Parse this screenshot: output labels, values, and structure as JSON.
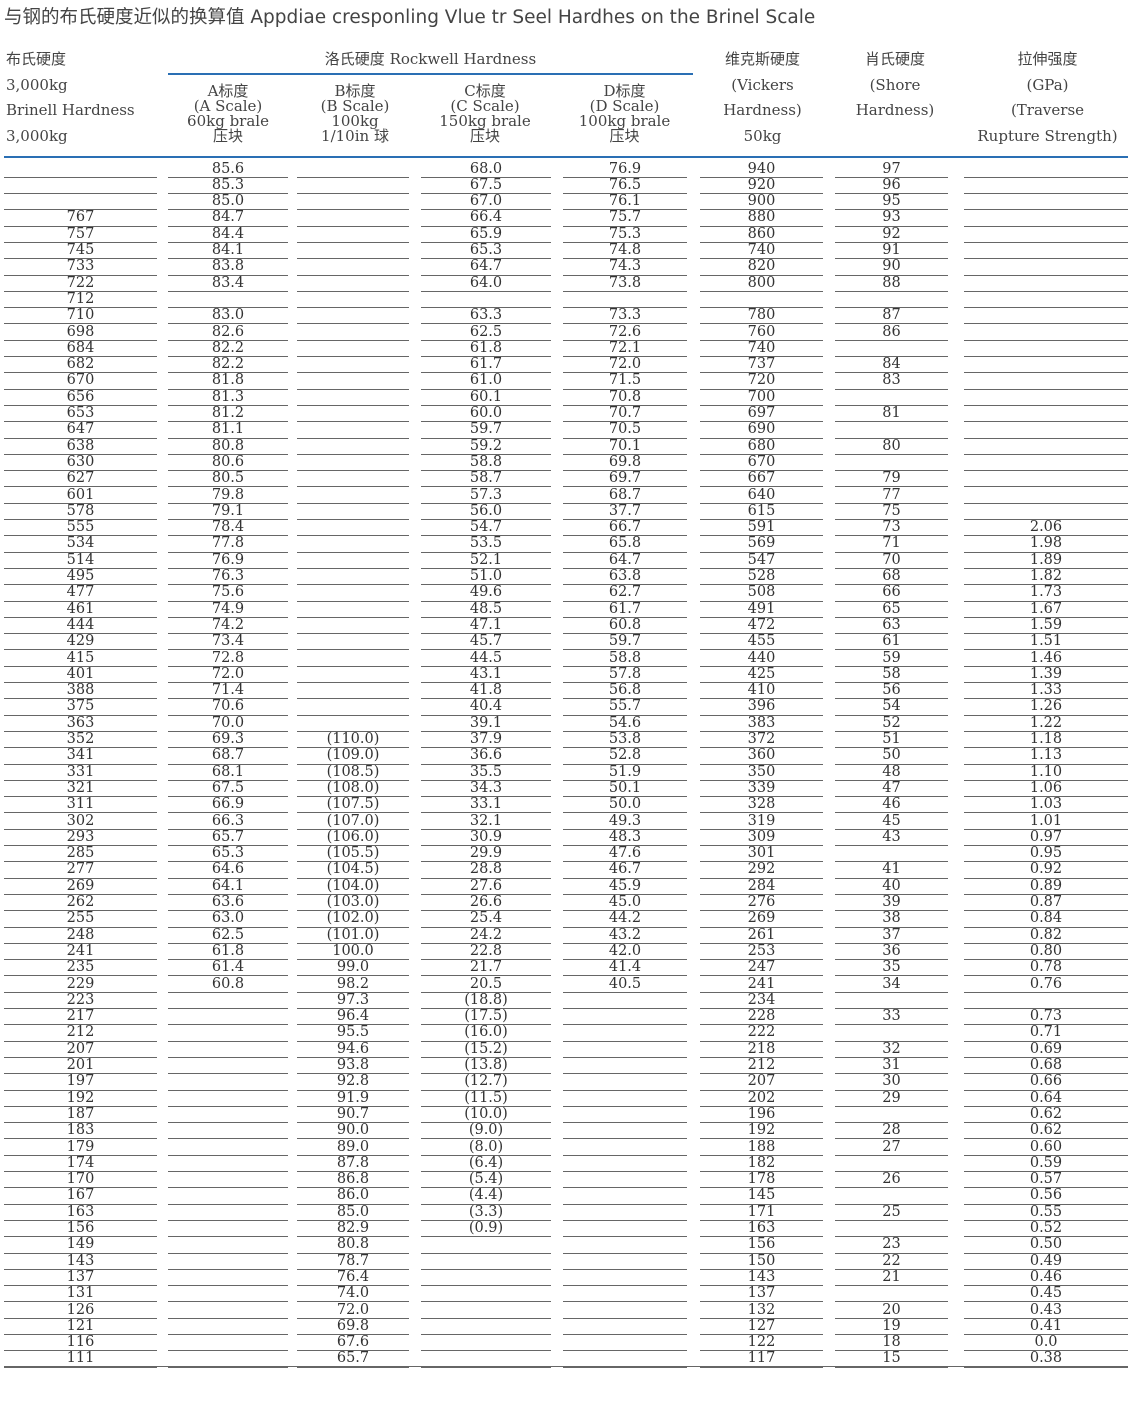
{
  "title": "与钢的布氏硬度近似的换算值 Appdiae cresponling Vlue tr Seel Hardhes on the Brinel Scale",
  "header": {
    "brinell": [
      "布氏硬度",
      "3,000kg",
      "Brinell Hardness",
      "3,000kg"
    ],
    "rockwell": "洛氏硬度 Rockwell Hardness",
    "a_scale": [
      "A标度",
      "(A Scale)",
      "60kg brale",
      "压块"
    ],
    "b_scale": [
      "B标度",
      "(B Scale)",
      "100kg",
      "1/10in 球"
    ],
    "c_scale": [
      "C标度",
      "(C Scale)",
      "150kg brale",
      "压块"
    ],
    "d_scale": [
      "D标度",
      "(D Scale)",
      "100kg brale",
      "压块"
    ],
    "vickers": [
      "维克斯硬度",
      "(Vickers",
      "Hardness)",
      "50kg"
    ],
    "shore": [
      "肖氏硬度",
      "(Shore",
      "Hardness)"
    ],
    "tensile": [
      "拉伸强度",
      "(GPa)",
      "(Traverse",
      "Rupture Strength)"
    ]
  },
  "rows": [
    [
      "",
      "85.6",
      "",
      "68.0",
      "76.9",
      "940",
      "97",
      ""
    ],
    [
      "",
      "85.3",
      "",
      "67.5",
      "76.5",
      "920",
      "96",
      ""
    ],
    [
      "",
      "85.0",
      "",
      "67.0",
      "76.1",
      "900",
      "95",
      ""
    ],
    [
      "767",
      "84.7",
      "",
      "66.4",
      "75.7",
      "880",
      "93",
      ""
    ],
    [
      "757",
      "84.4",
      "",
      "65.9",
      "75.3",
      "860",
      "92",
      ""
    ],
    [
      "745",
      "84.1",
      "",
      "65.3",
      "74.8",
      "740",
      "91",
      ""
    ],
    [
      "733",
      "83.8",
      "",
      "64.7",
      "74.3",
      "820",
      "90",
      ""
    ],
    [
      "722",
      "83.4",
      "",
      "64.0",
      "73.8",
      "800",
      "88",
      ""
    ],
    [
      "712",
      "",
      "",
      "",
      "",
      "",
      "",
      ""
    ],
    [
      "710",
      "83.0",
      "",
      "63.3",
      "73.3",
      "780",
      "87",
      ""
    ],
    [
      "698",
      "82.6",
      "",
      "62.5",
      "72.6",
      "760",
      "86",
      ""
    ],
    [
      "684",
      "82.2",
      "",
      "61.8",
      "72.1",
      "740",
      "",
      ""
    ],
    [
      "682",
      "82.2",
      "",
      "61.7",
      "72.0",
      "737",
      "84",
      ""
    ],
    [
      "670",
      "81.8",
      "",
      "61.0",
      "71.5",
      "720",
      "83",
      ""
    ],
    [
      "656",
      "81.3",
      "",
      "60.1",
      "70.8",
      "700",
      "",
      ""
    ],
    [
      "653",
      "81.2",
      "",
      "60.0",
      "70.7",
      "697",
      "81",
      ""
    ],
    [
      "647",
      "81.1",
      "",
      "59.7",
      "70.5",
      "690",
      "",
      ""
    ],
    [
      "638",
      "80.8",
      "",
      "59.2",
      "70.1",
      "680",
      "80",
      ""
    ],
    [
      "630",
      "80.6",
      "",
      "58.8",
      "69.8",
      "670",
      "",
      ""
    ],
    [
      "627",
      "80.5",
      "",
      "58.7",
      "69.7",
      "667",
      "79",
      ""
    ],
    [
      "601",
      "79.8",
      "",
      "57.3",
      "68.7",
      "640",
      "77",
      ""
    ],
    [
      "578",
      "79.1",
      "",
      "56.0",
      "37.7",
      "615",
      "75",
      ""
    ],
    [
      "555",
      "78.4",
      "",
      "54.7",
      "66.7",
      "591",
      "73",
      "2.06"
    ],
    [
      "534",
      "77.8",
      "",
      "53.5",
      "65.8",
      "569",
      "71",
      "1.98"
    ],
    [
      "514",
      "76.9",
      "",
      "52.1",
      "64.7",
      "547",
      "70",
      "1.89"
    ],
    [
      "495",
      "76.3",
      "",
      "51.0",
      "63.8",
      "528",
      "68",
      "1.82"
    ],
    [
      "477",
      "75.6",
      "",
      "49.6",
      "62.7",
      "508",
      "66",
      "1.73"
    ],
    [
      "461",
      "74.9",
      "",
      "48.5",
      "61.7",
      "491",
      "65",
      "1.67"
    ],
    [
      "444",
      "74.2",
      "",
      "47.1",
      "60.8",
      "472",
      "63",
      "1.59"
    ],
    [
      "429",
      "73.4",
      "",
      "45.7",
      "59.7",
      "455",
      "61",
      "1.51"
    ],
    [
      "415",
      "72.8",
      "",
      "44.5",
      "58.8",
      "440",
      "59",
      "1.46"
    ],
    [
      "401",
      "72.0",
      "",
      "43.1",
      "57.8",
      "425",
      "58",
      "1.39"
    ],
    [
      "388",
      "71.4",
      "",
      "41.8",
      "56.8",
      "410",
      "56",
      "1.33"
    ],
    [
      "375",
      "70.6",
      "",
      "40.4",
      "55.7",
      "396",
      "54",
      "1.26"
    ],
    [
      "363",
      "70.0",
      "",
      "39.1",
      "54.6",
      "383",
      "52",
      "1.22"
    ],
    [
      "352",
      "69.3",
      "(110.0)",
      "37.9",
      "53.8",
      "372",
      "51",
      "1.18"
    ],
    [
      "341",
      "68.7",
      "(109.0)",
      "36.6",
      "52.8",
      "360",
      "50",
      "1.13"
    ],
    [
      "331",
      "68.1",
      "(108.5)",
      "35.5",
      "51.9",
      "350",
      "48",
      "1.10"
    ],
    [
      "321",
      "67.5",
      "(108.0)",
      "34.3",
      "50.1",
      "339",
      "47",
      "1.06"
    ],
    [
      "311",
      "66.9",
      "(107.5)",
      "33.1",
      "50.0",
      "328",
      "46",
      "1.03"
    ],
    [
      "302",
      "66.3",
      "(107.0)",
      "32.1",
      "49.3",
      "319",
      "45",
      "1.01"
    ],
    [
      "293",
      "65.7",
      "(106.0)",
      "30.9",
      "48.3",
      "309",
      "43",
      "0.97"
    ],
    [
      "285",
      "65.3",
      "(105.5)",
      "29.9",
      "47.6",
      "301",
      "",
      "0.95"
    ],
    [
      "277",
      "64.6",
      "(104.5)",
      "28.8",
      "46.7",
      "292",
      "41",
      "0.92"
    ],
    [
      "269",
      "64.1",
      "(104.0)",
      "27.6",
      "45.9",
      "284",
      "40",
      "0.89"
    ],
    [
      "262",
      "63.6",
      "(103.0)",
      "26.6",
      "45.0",
      "276",
      "39",
      "0.87"
    ],
    [
      "255",
      "63.0",
      "(102.0)",
      "25.4",
      "44.2",
      "269",
      "38",
      "0.84"
    ],
    [
      "248",
      "62.5",
      "(101.0)",
      "24.2",
      "43.2",
      "261",
      "37",
      "0.82"
    ],
    [
      "241",
      "61.8",
      "100.0",
      "22.8",
      "42.0",
      "253",
      "36",
      "0.80"
    ],
    [
      "235",
      "61.4",
      "99.0",
      "21.7",
      "41.4",
      "247",
      "35",
      "0.78"
    ],
    [
      "229",
      "60.8",
      "98.2",
      "20.5",
      "40.5",
      "241",
      "34",
      "0.76"
    ],
    [
      "223",
      "",
      "97.3",
      "(18.8)",
      "",
      "234",
      "",
      ""
    ],
    [
      "217",
      "",
      "96.4",
      "(17.5)",
      "",
      "228",
      "33",
      "0.73"
    ],
    [
      "212",
      "",
      "95.5",
      "(16.0)",
      "",
      "222",
      "",
      "0.71"
    ],
    [
      "207",
      "",
      "94.6",
      "(15.2)",
      "",
      "218",
      "32",
      "0.69"
    ],
    [
      "201",
      "",
      "93.8",
      "(13.8)",
      "",
      "212",
      "31",
      "0.68"
    ],
    [
      "197",
      "",
      "92.8",
      "(12.7)",
      "",
      "207",
      "30",
      "0.66"
    ],
    [
      "192",
      "",
      "91.9",
      "(11.5)",
      "",
      "202",
      "29",
      "0.64"
    ],
    [
      "187",
      "",
      "90.7",
      "(10.0)",
      "",
      "196",
      "",
      "0.62"
    ],
    [
      "183",
      "",
      "90.0",
      "(9.0)",
      "",
      "192",
      "28",
      "0.62"
    ],
    [
      "179",
      "",
      "89.0",
      "(8.0)",
      "",
      "188",
      "27",
      "0.60"
    ],
    [
      "174",
      "",
      "87.8",
      "(6.4)",
      "",
      "182",
      "",
      "0.59"
    ],
    [
      "170",
      "",
      "86.8",
      "(5.4)",
      "",
      "178",
      "26",
      "0.57"
    ],
    [
      "167",
      "",
      "86.0",
      "(4.4)",
      "",
      "145",
      "",
      "0.56"
    ],
    [
      "163",
      "",
      "85.0",
      "(3.3)",
      "",
      "171",
      "25",
      "0.55"
    ],
    [
      "156",
      "",
      "82.9",
      "(0.9)",
      "",
      "163",
      "",
      "0.52"
    ],
    [
      "149",
      "",
      "80.8",
      "",
      "",
      "156",
      "23",
      "0.50"
    ],
    [
      "143",
      "",
      "78.7",
      "",
      "",
      "150",
      "22",
      "0.49"
    ],
    [
      "137",
      "",
      "76.4",
      "",
      "",
      "143",
      "21",
      "0.46"
    ],
    [
      "131",
      "",
      "74.0",
      "",
      "",
      "137",
      "",
      "0.45"
    ],
    [
      "126",
      "",
      "72.0",
      "",
      "",
      "132",
      "20",
      "0.43"
    ],
    [
      "121",
      "",
      "69.8",
      "",
      "",
      "127",
      "19",
      "0.41"
    ],
    [
      "116",
      "",
      "67.6",
      "",
      "",
      "122",
      "18",
      "0.0"
    ],
    [
      "111",
      "",
      "65.7",
      "",
      "",
      "117",
      "15",
      "0.38"
    ]
  ]
}
